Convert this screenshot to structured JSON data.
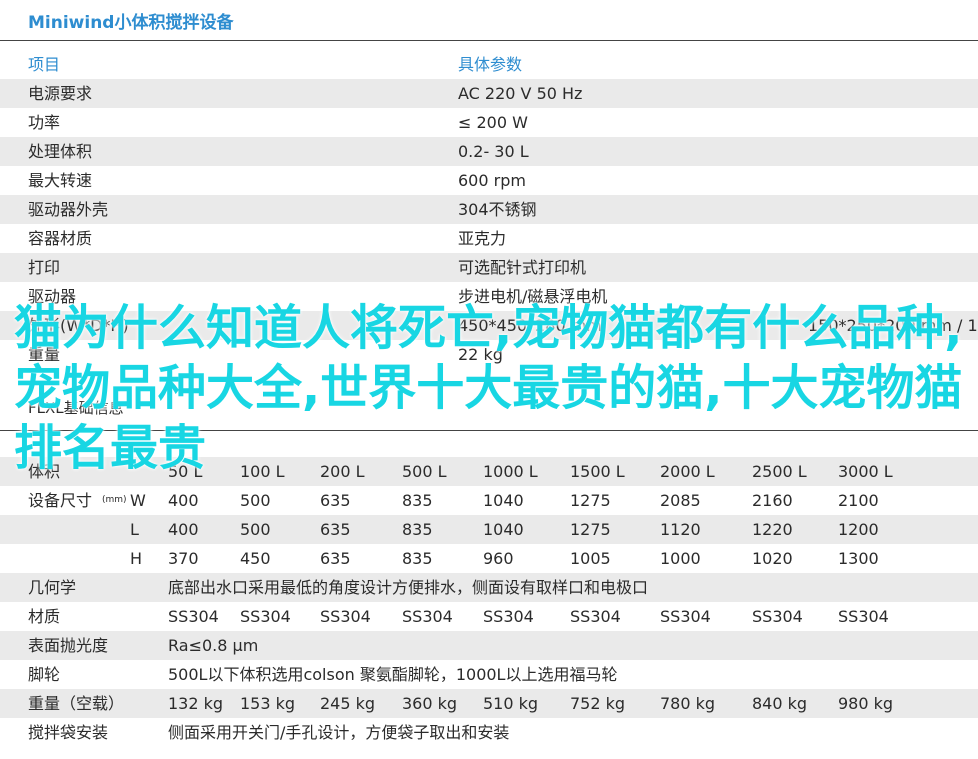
{
  "title": "Miniwind小体积搅拌设备",
  "spec_table": {
    "headers": [
      "项目",
      "具体参数"
    ],
    "rows": [
      [
        "电源要求",
        "AC 220  V 50 Hz"
      ],
      [
        "功率",
        "≤ 200 W"
      ],
      [
        "处理体积",
        "0.2-  30 L"
      ],
      [
        "最大转速",
        "600  rpm"
      ],
      [
        "驱动器外壳",
        "304不锈钢"
      ],
      [
        "容器材质",
        "亚克力"
      ],
      [
        "打印",
        "可选配针式打印机"
      ],
      [
        "驱动器",
        "步进电机/磁悬浮电机"
      ],
      [
        "外形(W*D*H)",
        "450*450*280 mm"
      ],
      [
        "重量",
        "22 kg"
      ]
    ],
    "note": "150*250*200 mm / 15 kg"
  },
  "overlay_text": "猫为什么知道人将死亡,宠物猫都有什么品种,宠物品种大全,世界十大最贵的猫,十大宠物猫排名最贵",
  "section2_title": "FLXL基础信息",
  "model_table": {
    "rows": [
      {
        "label": "体积",
        "sub": "",
        "values": [
          "50 L",
          "100 L",
          "200 L",
          "500 L",
          "1000 L",
          "1500 L",
          "2000 L",
          "2500 L",
          "3000 L"
        ]
      },
      {
        "label": "设备尺寸",
        "unit": "(mm)",
        "sub": "W",
        "values": [
          "400",
          "500",
          "635",
          "835",
          "1040",
          "1275",
          "2085",
          "2160",
          "2100"
        ]
      },
      {
        "label": "",
        "sub": "L",
        "values": [
          "400",
          "500",
          "635",
          "835",
          "1040",
          "1275",
          "1120",
          "1220",
          "1200"
        ]
      },
      {
        "label": "",
        "sub": "H",
        "values": [
          "370",
          "450",
          "635",
          "835",
          "960",
          "1005",
          "1000",
          "1020",
          "1300"
        ]
      }
    ],
    "geometry": {
      "label": "几何学",
      "text": "底部出水口采用最低的角度设计方便排水，侧面设有取样口和电极口"
    },
    "material": {
      "label": "材质",
      "values": [
        "SS304",
        "SS304",
        "SS304",
        "SS304",
        "SS304",
        "SS304",
        "SS304",
        "SS304",
        "SS304"
      ]
    },
    "polish": {
      "label": "表面抛光度",
      "text": "Ra≤0.8 µm"
    },
    "wheels": {
      "label": "脚轮",
      "text": "500L以下体积选用colson 聚氨酯脚轮，1000L以上选用福马轮"
    },
    "weight": {
      "label": "重量（空载）",
      "values": [
        "132 kg",
        "153 kg",
        "245 kg",
        "360 kg",
        "510 kg",
        "752 kg",
        "780 kg",
        "840 kg",
        "980 kg"
      ]
    },
    "bag": {
      "label": "搅拌袋安装",
      "text": "侧面采用开关门/手孔设计，方便袋子取出和安装"
    }
  }
}
